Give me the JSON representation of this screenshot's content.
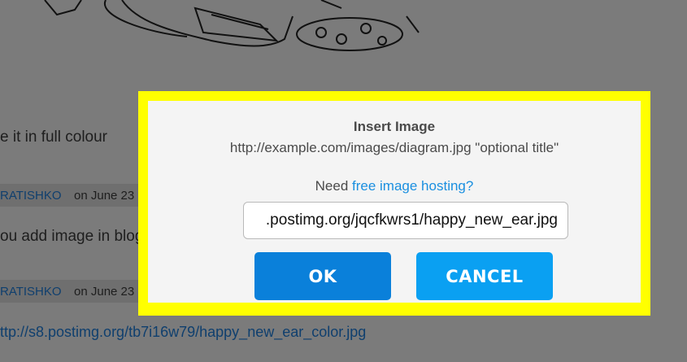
{
  "background": {
    "snippet_1": "e it in full colour",
    "comments": [
      {
        "author": "RATISHKO",
        "date": "on June 23"
      },
      {
        "author": "RATISHKO",
        "date": "on June 23"
      }
    ],
    "snippet_2": "ou add image in blog",
    "link_text": "ttp://s8.postimg.org/tb7i16w79/happy_new_ear_color.jpg"
  },
  "dialog": {
    "title": "Insert Image",
    "hint": "http://example.com/images/diagram.jpg \"optional title\"",
    "hosting_prefix": "Need",
    "hosting_link": "free image hosting?",
    "url_value": ".postimg.org/jqcfkwrs1/happy_new_ear.jpg",
    "ok_label": "OK",
    "cancel_label": "CANCEL"
  },
  "colors": {
    "highlight_frame": "#ffff00",
    "ok_button": "#0a80da",
    "cancel_button": "#0aa0f2",
    "link": "#1a8fe0"
  }
}
